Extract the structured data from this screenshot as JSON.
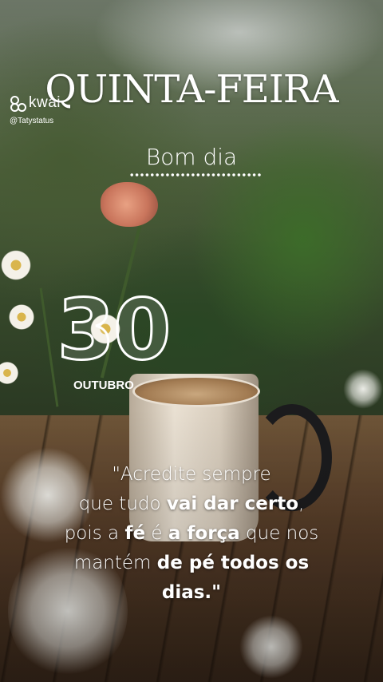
{
  "watermark": {
    "brand": "kwai",
    "handle": "@Tatystatus"
  },
  "header": {
    "day": "QUINTA-FEIRA",
    "greeting": "Bom dia"
  },
  "date": {
    "day_number": "30",
    "month": "OUTUBRO"
  },
  "quote": {
    "segments": [
      {
        "text": "\"Acredite sempre",
        "bold": false
      },
      {
        "text": "que tudo ",
        "bold": false
      },
      {
        "text": "vai dar certo",
        "bold": true
      },
      {
        "text": ",",
        "bold": false
      },
      {
        "text": "pois a ",
        "bold": false
      },
      {
        "text": "fé",
        "bold": true
      },
      {
        "text": " é ",
        "bold": false
      },
      {
        "text": "a força",
        "bold": true
      },
      {
        "text": " que nos",
        "bold": false
      },
      {
        "text": "mantém ",
        "bold": false
      },
      {
        "text": "de pé todos os",
        "bold": true
      },
      {
        "text": "dias.\"",
        "bold": true
      }
    ]
  },
  "colors": {
    "text": "#ffffff",
    "mug_handle": "#1b1b1d",
    "rose": "#c9755c"
  }
}
